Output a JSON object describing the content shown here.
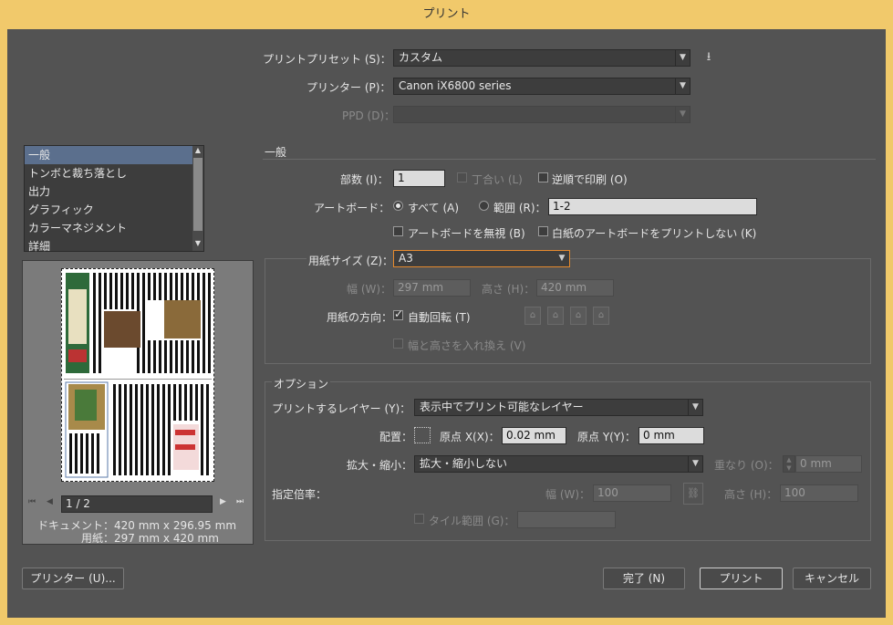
{
  "window": {
    "title": "プリント"
  },
  "top": {
    "preset_label": "プリントプリセット (S)：",
    "preset_value": "カスタム",
    "printer_label": "プリンター (P)：",
    "printer_value": "Canon iX6800 series",
    "ppd_label": "PPD (D)："
  },
  "sidebar": {
    "items": [
      {
        "label": "一般",
        "selected": true
      },
      {
        "label": "トンボと裁ち落とし"
      },
      {
        "label": "出力"
      },
      {
        "label": "グラフィック"
      },
      {
        "label": "カラーマネジメント"
      },
      {
        "label": "詳細"
      }
    ]
  },
  "preview": {
    "page_indicator": "1 / 2",
    "document_info": "ドキュメント：420 mm x 296.95 mm",
    "paper_info": "用紙：297 mm x 420 mm"
  },
  "general": {
    "section_title": "一般",
    "copies_label": "部数 (I)：",
    "copies_value": "1",
    "collate_label": "丁合い (L)",
    "reverse_label": "逆順で印刷 (O)",
    "artboard_label": "アートボード：",
    "all_label": "すべて (A)",
    "range_label": "範囲 (R)：",
    "range_value": "1-2",
    "ignore_artboards_label": "アートボードを無視 (B)",
    "skip_blank_label": "白紙のアートボードをプリントしない (K)"
  },
  "paper": {
    "size_label": "用紙サイズ (Z)：",
    "size_value": "A3",
    "width_label": "幅 (W)：",
    "width_value": "297 mm",
    "height_label": "高さ (H)：",
    "height_value": "420 mm",
    "orientation_label": "用紙の方向：",
    "auto_rotate_label": "自動回転 (T)",
    "swap_label": "幅と高さを入れ換え (V)"
  },
  "options": {
    "section_title": "オプション",
    "layers_label": "プリントするレイヤー (Y)：",
    "layers_value": "表示中でプリント可能なレイヤー",
    "placement_label": "配置：",
    "origin_x_label": "原点 X(X)：",
    "origin_x_value": "0.02 mm",
    "origin_y_label": "原点 Y(Y)：",
    "origin_y_value": "0 mm",
    "scale_label": "拡大・縮小：",
    "scale_value": "拡大・縮小しない",
    "overlap_label": "重なり (O)：",
    "overlap_value": "0 mm",
    "custom_scale_label": "指定倍率：",
    "scale_width_label": "幅 (W)：",
    "scale_width_value": "100",
    "scale_height_label": "高さ (H)：",
    "scale_height_value": "100",
    "tile_label": "タイル範囲 (G)："
  },
  "buttons": {
    "printer": "プリンター (U)...",
    "done": "完了 (N)",
    "print": "プリント",
    "cancel": "キャンセル"
  },
  "colors": {
    "title_bar": "#f1c96b",
    "panel": "#535353",
    "selection": "#5b6f8d",
    "focus": "#e68a2e"
  }
}
